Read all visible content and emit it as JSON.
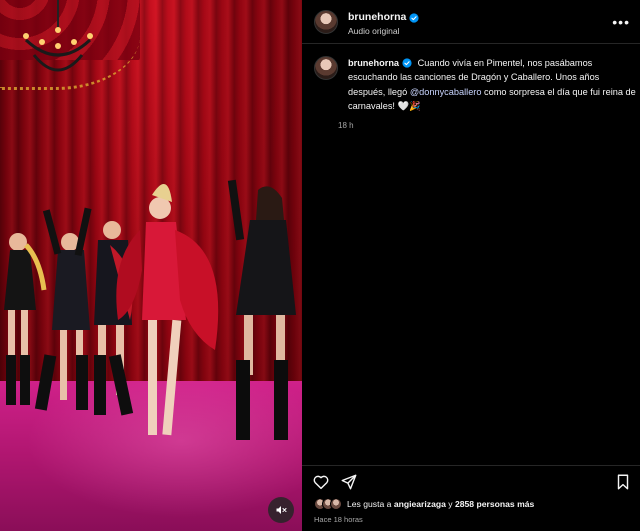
{
  "post": {
    "author": "brunehorna",
    "audio_label": "Audio original",
    "more_icon": "more-horizontal-icon",
    "caption_parts": {
      "before_mention": "Cuando vivía en Pimentel, nos pasábamos escuchando las canciones de Dragón y Caballero. Unos años después, llegó",
      "mention": "@donnycaballero",
      "after_mention": "como sorpresa el día que fui reina de carnavales! 🤍🎉"
    },
    "caption_time": "18 h",
    "likes": {
      "prefix": "Les gusta a",
      "first_user": "angiearizaga",
      "connector": "y",
      "others": "2858 personas más"
    },
    "posted_ago": "Hace 18 horas"
  },
  "media": {
    "mute_icon": "speaker-muted-icon"
  },
  "actions": {
    "like_icon": "heart-icon",
    "share_icon": "paper-plane-icon",
    "save_icon": "bookmark-icon"
  },
  "colors": {
    "background": "#000000",
    "verified": "#0095f6",
    "mention": "#c9d5ff",
    "muted_text": "#a8a8a8",
    "stage_curtain": "#b0101e",
    "stage_floor": "#d0218a"
  }
}
